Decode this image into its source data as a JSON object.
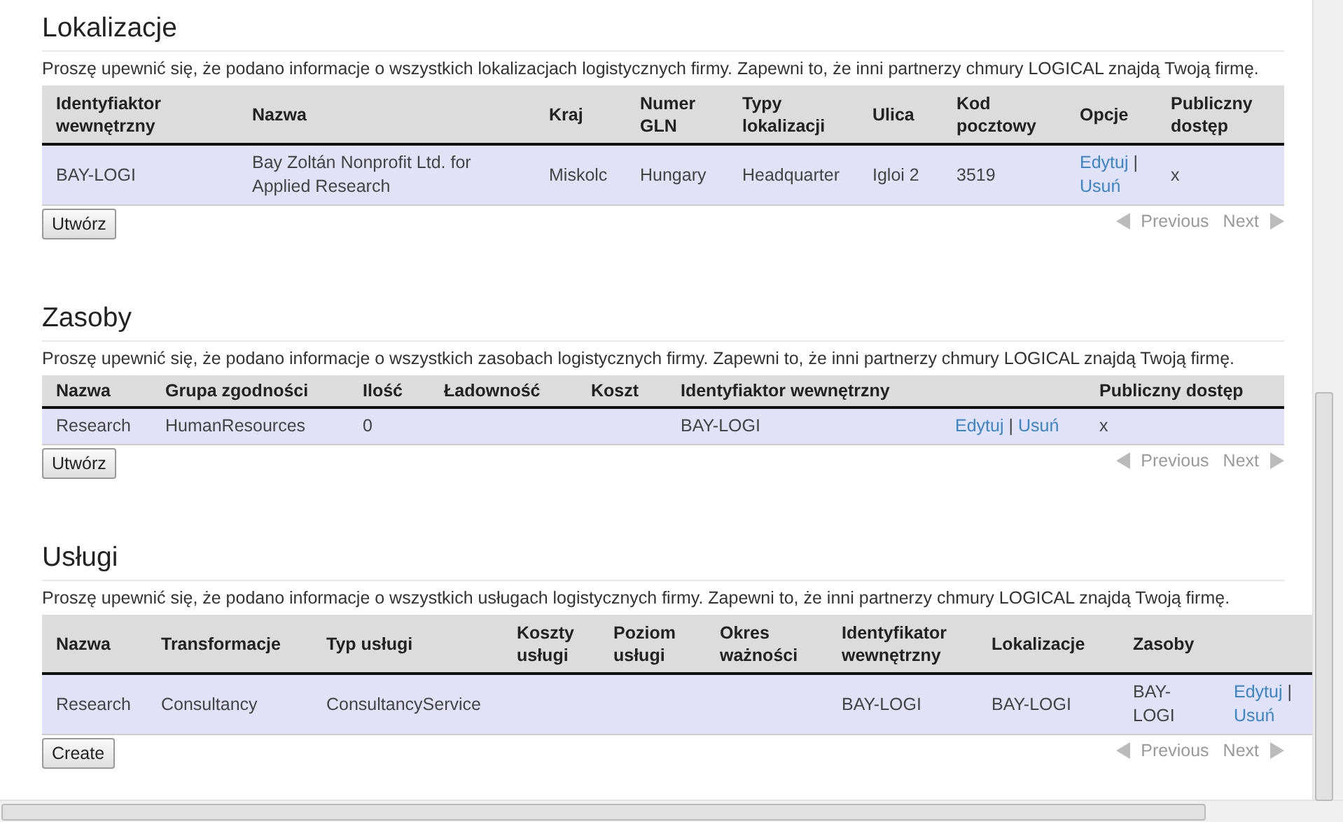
{
  "sections": [
    {
      "title": "Lokalizacje",
      "description": "Proszę upewnić się, że podano informacje o wszystkich lokalizacjach logistycznych firmy. Zapewni to, że inni partnerzy chmury LOGICAL znajdą Twoją firmę.",
      "columns": [
        {
          "label": "Identyfiaktor wewnętrzny"
        },
        {
          "label": "Nazwa"
        },
        {
          "label": "Kraj"
        },
        {
          "label": "Numer GLN"
        },
        {
          "label": "Typy lokalizacji"
        },
        {
          "label": "Ulica"
        },
        {
          "label": "Kod pocztowy"
        },
        {
          "label": "Opcje"
        },
        {
          "label": "Publiczny dostęp"
        }
      ],
      "rows": [
        {
          "cells": [
            {
              "kind": "text",
              "text": "BAY-LOGI"
            },
            {
              "kind": "text",
              "text": "Bay Zoltán Nonprofit Ltd. for Applied Research"
            },
            {
              "kind": "text",
              "text": "Miskolc"
            },
            {
              "kind": "text",
              "text": "Hungary"
            },
            {
              "kind": "text",
              "text": "Headquarter"
            },
            {
              "kind": "text",
              "text": "Igloi 2"
            },
            {
              "kind": "text",
              "text": "3519"
            },
            {
              "kind": "links",
              "links": [
                "Edytuj",
                "Usuń"
              ],
              "separator": "|"
            },
            {
              "kind": "text",
              "text": "x"
            }
          ]
        }
      ],
      "create_button": "Utwórz",
      "pagination": {
        "previous": "Previous",
        "next": "Next"
      }
    },
    {
      "title": "Zasoby",
      "description": "Proszę upewnić się, że podano informacje o wszystkich zasobach logistycznych firmy. Zapewni to, że inni partnerzy chmury LOGICAL znajdą Twoją firmę.",
      "columns": [
        {
          "label": "Nazwa"
        },
        {
          "label": "Grupa zgodności"
        },
        {
          "label": "Ilość"
        },
        {
          "label": "Ładowność"
        },
        {
          "label": "Koszt"
        },
        {
          "label": "Identyfiaktor wewnętrzny"
        },
        {},
        {
          "label": "Publiczny dostęp"
        }
      ],
      "rows": [
        {
          "cells": [
            {
              "kind": "text",
              "text": "Research"
            },
            {
              "kind": "text",
              "text": "HumanResources"
            },
            {
              "kind": "text",
              "text": "0"
            },
            {
              "kind": "empty"
            },
            {
              "kind": "empty"
            },
            {
              "kind": "text",
              "text": "BAY-LOGI"
            },
            {
              "kind": "links",
              "links": [
                "Edytuj",
                "Usuń"
              ],
              "separator": "|"
            },
            {
              "kind": "text",
              "text": "x"
            }
          ]
        }
      ],
      "create_button": "Utwórz",
      "pagination": {
        "previous": "Previous",
        "next": "Next"
      }
    },
    {
      "title": "Usługi",
      "description": "Proszę upewnić się, że podano informacje o wszystkich usługach logistycznych firmy. Zapewni to, że inni partnerzy chmury LOGICAL znajdą Twoją firmę.",
      "columns": [
        {
          "label": "Nazwa"
        },
        {
          "label": "Transformacje"
        },
        {
          "label": "Typ usługi"
        },
        {
          "label": "Koszty usługi"
        },
        {
          "label": "Poziom usługi"
        },
        {
          "label": "Okres ważności"
        },
        {
          "label": "Identyfikator wewnętrzny"
        },
        {
          "label": "Lokalizacje"
        },
        {
          "label": "Zasoby"
        },
        {}
      ],
      "rows": [
        {
          "cells": [
            {
              "kind": "text",
              "text": "Research"
            },
            {
              "kind": "text",
              "text": "Consultancy"
            },
            {
              "kind": "text",
              "text": "ConsultancyService"
            },
            {
              "kind": "empty"
            },
            {
              "kind": "empty"
            },
            {
              "kind": "empty"
            },
            {
              "kind": "text",
              "text": "BAY-LOGI"
            },
            {
              "kind": "text",
              "text": "BAY-LOGI"
            },
            {
              "kind": "text",
              "text": "BAY-LOGI"
            },
            {
              "kind": "links",
              "links": [
                "Edytuj",
                "Usuń"
              ],
              "separator": "|"
            }
          ]
        }
      ],
      "create_button": "Create",
      "pagination": {
        "previous": "Previous",
        "next": "Next"
      }
    }
  ]
}
